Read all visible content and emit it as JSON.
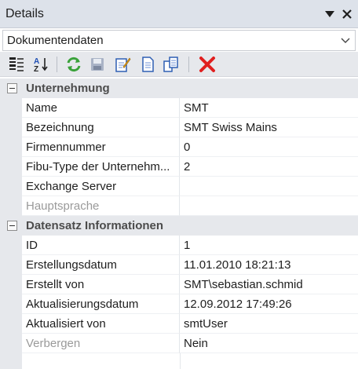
{
  "panel": {
    "title": "Details"
  },
  "dropdown": {
    "value": "Dokumentendaten"
  },
  "toolbar": {
    "tools": [
      "categorized-icon",
      "alphabetical-sort-icon",
      "refresh-icon",
      "save-icon",
      "edit-icon",
      "document-icon",
      "copy-icon",
      "delete-icon"
    ]
  },
  "categories": [
    {
      "label": "Unternehmung",
      "props": [
        {
          "name": "Name",
          "value": "SMT"
        },
        {
          "name": "Bezeichnung",
          "value": "SMT Swiss Mains"
        },
        {
          "name": "Firmennummer",
          "value": "0"
        },
        {
          "name": "Fibu-Type der Unternehm...",
          "value": "2"
        },
        {
          "name": "Exchange Server",
          "value": ""
        },
        {
          "name": "Hauptsprache",
          "value": "",
          "disabled": true
        }
      ]
    },
    {
      "label": "Datensatz Informationen",
      "props": [
        {
          "name": "ID",
          "value": "1"
        },
        {
          "name": "Erstellungsdatum",
          "value": "11.01.2010 18:21:13"
        },
        {
          "name": "Erstellt von",
          "value": "SMT\\sebastian.schmid"
        },
        {
          "name": "Aktualisierungsdatum",
          "value": "12.09.2012 17:49:26"
        },
        {
          "name": "Aktualisiert von",
          "value": "smtUser"
        },
        {
          "name": "Verbergen",
          "value": "Nein",
          "disabled": true
        }
      ]
    }
  ],
  "colors": {
    "header": "#dde2ea",
    "category": "#e6e8ec",
    "delete": "#e01f1f",
    "refresh": "#3aa23a"
  }
}
